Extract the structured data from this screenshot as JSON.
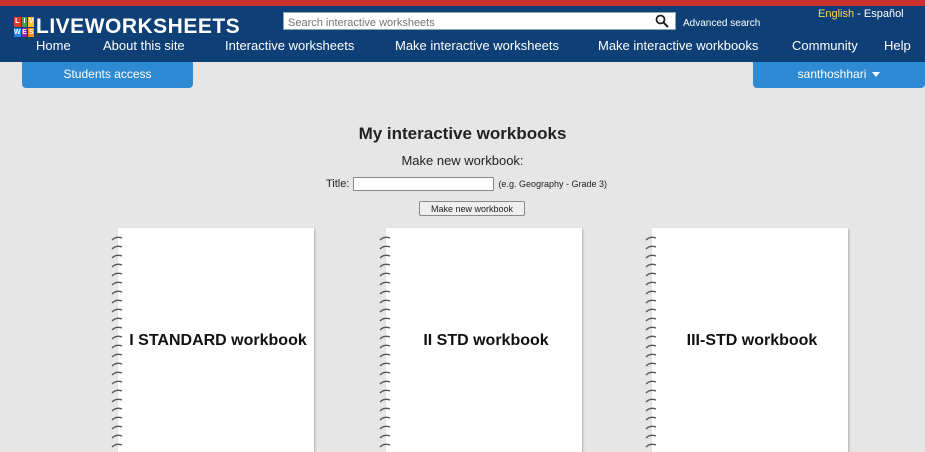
{
  "header": {
    "logo_text": "LIVEWORKSHEETS",
    "logo_letters": [
      "L",
      "I",
      "V",
      "W",
      "E",
      "S"
    ],
    "search_placeholder": "Search interactive worksheets",
    "search_icon": "search-icon",
    "advanced_search": "Advanced search",
    "languages": {
      "english": "English",
      "separator": "-",
      "spanish": "Español"
    }
  },
  "nav": {
    "items": [
      "Home",
      "About this site",
      "Interactive worksheets",
      "Make interactive worksheets",
      "Make interactive workbooks",
      "Community",
      "Help"
    ]
  },
  "tabs": {
    "students_access": "Students access",
    "username": "santhoshhari"
  },
  "main": {
    "title": "My interactive workbooks",
    "make_new": "Make new workbook:",
    "title_label": "Title:",
    "title_value": "",
    "title_hint": "(e.g. Geography - Grade 3)",
    "button_label": "Make new workbook"
  },
  "workbooks": [
    {
      "title": "I STANDARD workbook"
    },
    {
      "title": "II STD workbook"
    },
    {
      "title": "III-STD workbook"
    }
  ],
  "colors": {
    "header_bg": "#0e3f76",
    "top_line": "#c8312c",
    "tab_bg": "#2e8ad2",
    "page_bg": "#e6e6e6",
    "lang_active": "#ffd84a"
  }
}
